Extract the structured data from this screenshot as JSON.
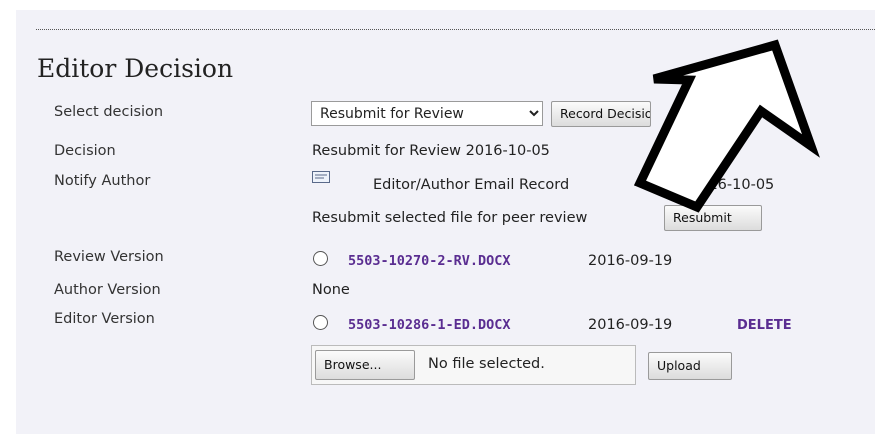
{
  "section": {
    "title": "Editor Decision"
  },
  "rows": {
    "select_decision_label": "Select decision",
    "decision_label": "Decision",
    "notify_author_label": "Notify Author",
    "review_version_label": "Review Version",
    "author_version_label": "Author Version",
    "editor_version_label": "Editor Version"
  },
  "decision_select": {
    "selected": "Resubmit for Review",
    "record_button": "Record Decision"
  },
  "decision": {
    "value": "Resubmit for Review  2016-10-05"
  },
  "notify": {
    "email_record": "Editor/Author Email Record",
    "date": "2016-10-05",
    "resubmit_text": "Resubmit selected file for peer review",
    "resubmit_button": "Resubmit"
  },
  "review_version": {
    "file": "5503-10270-2-RV.DOCX",
    "date": "2016-09-19"
  },
  "author_version": {
    "value": "None"
  },
  "editor_version": {
    "file": "5503-10286-1-ED.DOCX",
    "date": "2016-09-19",
    "delete_link": "DELETE"
  },
  "upload": {
    "browse_button": "Browse...",
    "file_status": "No file selected.",
    "upload_button": "Upload"
  },
  "icons": [
    "envelope-icon",
    "comment-icon",
    "chevron-down-icon",
    "arrow-annotation"
  ]
}
